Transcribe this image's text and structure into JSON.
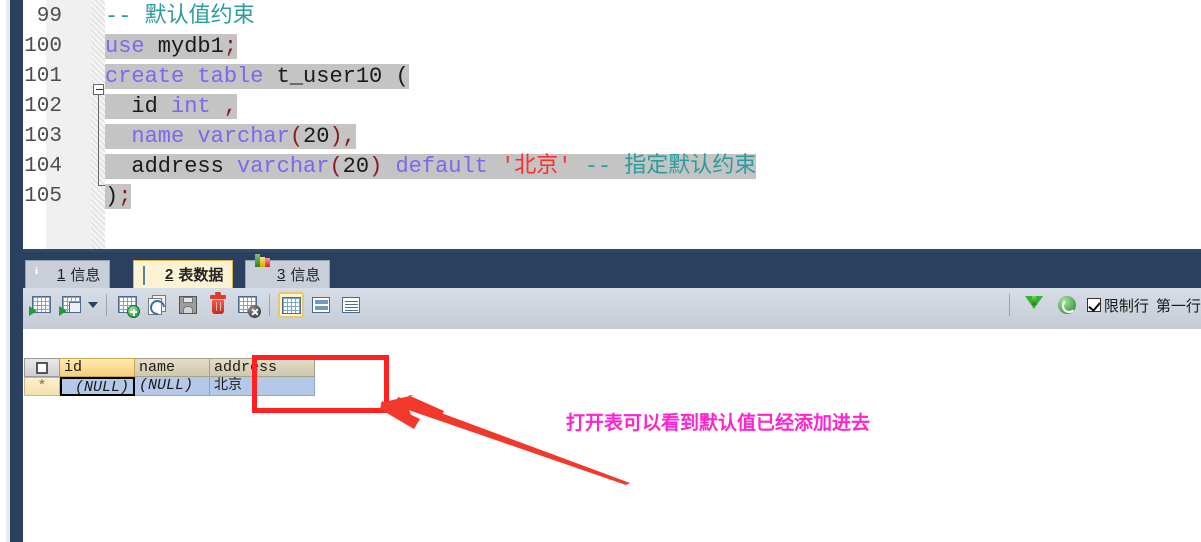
{
  "editor": {
    "lines": [
      {
        "num": "99",
        "segments": [
          {
            "t": "-- 默认值约束",
            "c": "cmt",
            "sel": false
          }
        ]
      },
      {
        "num": "100",
        "segments": [
          {
            "t": "use",
            "c": "kw",
            "sel": true
          },
          {
            "t": " mydb1",
            "c": "id",
            "sel": true
          },
          {
            "t": ";",
            "c": "punc",
            "sel": true
          }
        ]
      },
      {
        "num": "101",
        "segments": [
          {
            "t": "create table",
            "c": "kw",
            "sel": true
          },
          {
            "t": " t_user10 (",
            "c": "id",
            "sel": true
          }
        ]
      },
      {
        "num": "102",
        "segments": [
          {
            "t": "  id ",
            "c": "id",
            "sel": true
          },
          {
            "t": "int",
            "c": "kw",
            "sel": true
          },
          {
            "t": " ",
            "c": "id",
            "sel": true
          },
          {
            "t": ",",
            "c": "punc",
            "sel": true
          }
        ]
      },
      {
        "num": "103",
        "segments": [
          {
            "t": "  name ",
            "c": "kw",
            "sel": true
          },
          {
            "t": "varchar",
            "c": "kw",
            "sel": true
          },
          {
            "t": "(",
            "c": "num",
            "sel": true
          },
          {
            "t": "20",
            "c": "id",
            "sel": true
          },
          {
            "t": ")",
            "c": "num",
            "sel": true
          },
          {
            "t": ",",
            "c": "punc",
            "sel": true
          }
        ]
      },
      {
        "num": "104",
        "segments": [
          {
            "t": "  address ",
            "c": "id",
            "sel": true
          },
          {
            "t": "varchar",
            "c": "kw",
            "sel": true
          },
          {
            "t": "(",
            "c": "num",
            "sel": true
          },
          {
            "t": "20",
            "c": "id",
            "sel": true
          },
          {
            "t": ")",
            "c": "num",
            "sel": true
          },
          {
            "t": " ",
            "c": "id",
            "sel": true
          },
          {
            "t": "default",
            "c": "kw",
            "sel": true
          },
          {
            "t": " '北京'",
            "c": "str",
            "sel": true
          },
          {
            "t": " -- 指定默认约束",
            "c": "cmt",
            "sel": true
          }
        ]
      },
      {
        "num": "105",
        "segments": [
          {
            "t": ")",
            "c": "id",
            "sel": true
          },
          {
            "t": ";",
            "c": "punc",
            "sel": true
          }
        ]
      }
    ]
  },
  "tabs": [
    {
      "label_num": "1",
      "label_text": "信息",
      "icon": "info-ball-icon",
      "active": false
    },
    {
      "label_num": "2",
      "label_text": "表数据",
      "icon": "table-grid-icon",
      "active": true
    },
    {
      "label_num": "3",
      "label_text": "信息",
      "icon": "profile-chart-icon",
      "active": false
    }
  ],
  "toolbar": {
    "buttons": [
      {
        "name": "grid-insert-record-button",
        "icon": "grid-green-arrow-icon"
      },
      {
        "name": "grid-open-form-button",
        "icon": "grid-window-arrow-icon"
      },
      {
        "name": "grid-dropdown-button",
        "icon": "chevron-down-icon"
      },
      {
        "name": "add-record-button",
        "icon": "grid-plus-icon"
      },
      {
        "name": "duplicate-record-button",
        "icon": "copy-curve-icon"
      },
      {
        "name": "save-record-button",
        "icon": "floppy-save-icon"
      },
      {
        "name": "delete-record-button",
        "icon": "trash-icon"
      },
      {
        "name": "discard-changes-button",
        "icon": "grid-cancel-icon"
      },
      {
        "name": "view-grid-button",
        "icon": "grid-view-icon"
      },
      {
        "name": "view-form-button",
        "icon": "form-view-icon"
      },
      {
        "name": "view-text-button",
        "icon": "text-view-icon"
      }
    ],
    "filter_icon": "funnel-filter-icon",
    "refresh_icon": "refresh-icon",
    "limit_checkbox_label": "限制行",
    "first_row_label": "第一行:"
  },
  "grid": {
    "columns": [
      "id",
      "name",
      "address"
    ],
    "selected_column": "id",
    "row_marker": "*",
    "rows": [
      {
        "id": "(NULL)",
        "name": "(NULL)",
        "address": "北京"
      }
    ]
  },
  "annotations": {
    "note": "打开表可以看到默认值已经添加进去",
    "highlight_color": "#ff2020",
    "note_color": "#ff22d0"
  }
}
